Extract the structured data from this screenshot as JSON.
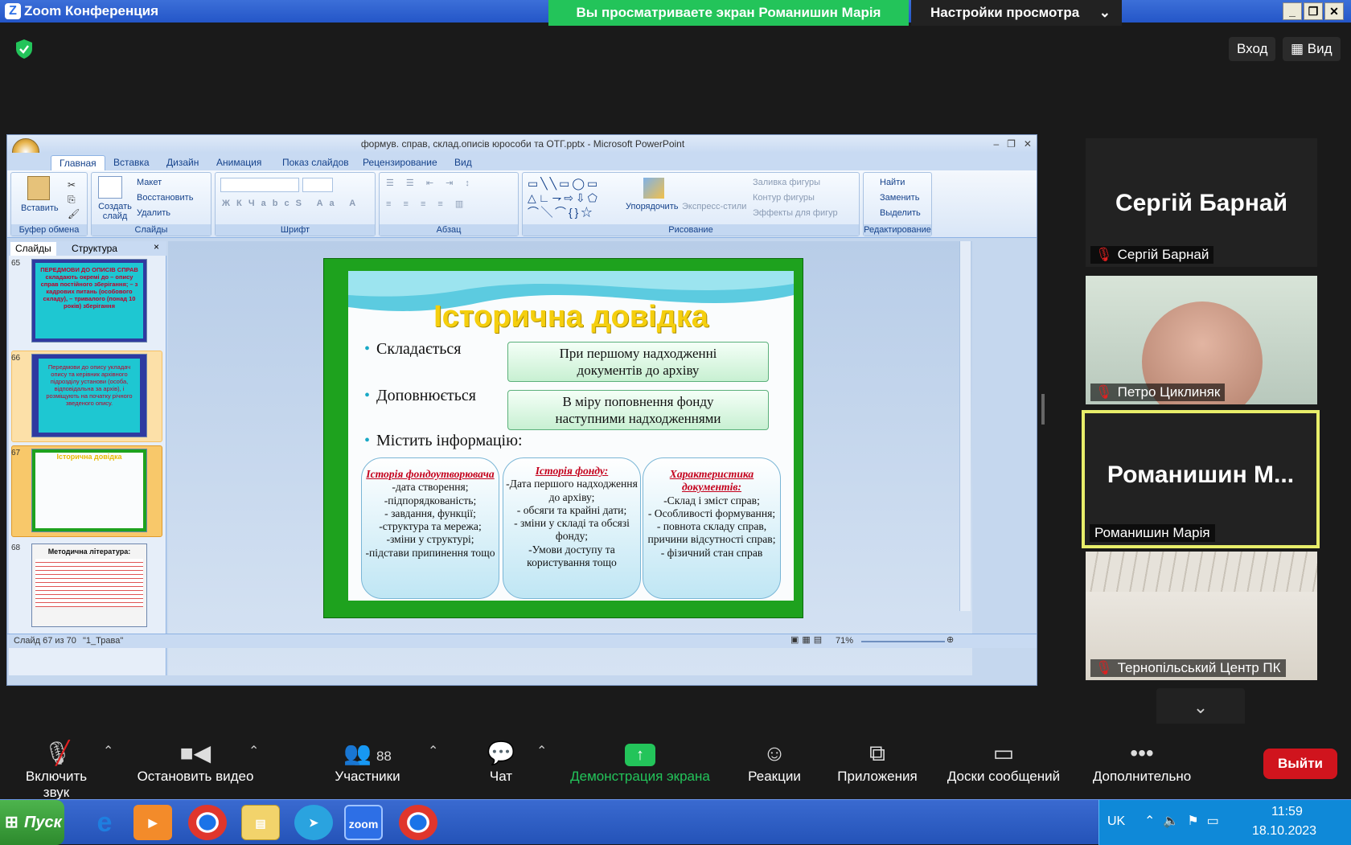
{
  "window": {
    "title": "Zoom Конференция",
    "logo_letter": "Z",
    "viewing_banner": "Вы просматриваете экран Романишин Марія",
    "view_settings": "Настройки просмотра"
  },
  "top_right": {
    "signin": "Вход",
    "view": "Вид"
  },
  "ppt": {
    "title": "формув. справ, склад.описів юрособи та ОТГ.pptx - Microsoft PowerPoint",
    "tabs": [
      "Главная",
      "Вставка",
      "Дизайн",
      "Анимация",
      "Показ слайдов",
      "Рецензирование",
      "Вид"
    ],
    "ribbon": {
      "paste": "Вставить",
      "clipboard_group": "Буфер обмена",
      "create_slide": "Создать слайд",
      "layout": "Макет",
      "restore": "Восстановить",
      "delete": "Удалить",
      "slides_group": "Слайды",
      "font_group": "Шрифт",
      "paragraph_group": "Абзац",
      "arrange": "Упорядочить",
      "express_styles": "Экспресс-стили",
      "shape_fill": "Заливка фигуры",
      "shape_outline": "Контур фигуры",
      "shape_effects": "Эффекты для фигур",
      "drawing_group": "Рисование",
      "find": "Найти",
      "replace": "Заменить",
      "select": "Выделить",
      "editing_group": "Редактирование"
    },
    "pane_tabs": {
      "slides": "Слайды",
      "outline": "Структура"
    },
    "thumbs": [
      {
        "num": "65",
        "text": "ПЕРЕДМОВИ ДО ОПИСІВ СПРАВ складають окремі до – опису справ постійного зберігання; – з кадрових питань (особового складу), – тривалого (понад 10 років) зберігання"
      },
      {
        "num": "66",
        "text": "Передмови до опису укладач опису та керівник архівного підрозділу установи (особа, відповідальна за архів), і розміщують на початку річного зведеного опису."
      },
      {
        "num": "67",
        "text": "Історична довідка"
      },
      {
        "num": "68",
        "text": "Методична література:"
      }
    ],
    "status": {
      "slide_info": "Слайд 67 из 70",
      "theme": "\"1_Трава\"",
      "zoom": "71%"
    }
  },
  "slide": {
    "title": "Історична довідка",
    "bullets": [
      "Складається",
      "Доповнюється",
      "Містить інформацію:"
    ],
    "box1": [
      "При першому надходженні",
      "документів до архіву"
    ],
    "box2": [
      "В міру поповнення фонду",
      "наступними надходженнями"
    ],
    "cards": [
      {
        "heading": "Історія фондоутворювача",
        "lines": [
          "-дата створення;",
          "-підпорядкованість;",
          "- завдання, функції;",
          "-структура та мережа;",
          "-зміни у структурі;",
          "-підстави припинення тощо"
        ]
      },
      {
        "heading": "Історія фонду:",
        "lines": [
          "-Дата першого надходження до архіву;",
          "- обсяги та крайні дати;",
          "- зміни у складі та обсязі фонду;",
          "-Умови доступу та користування тощо"
        ]
      },
      {
        "heading": "Характеристика документів:",
        "lines": [
          "-Склад і зміст справ;",
          "- Особливості формування;",
          "- повнота складу справ, причини відсутності справ;",
          "- фізичний стан справ"
        ]
      }
    ]
  },
  "participants_tiles": [
    {
      "big": "Сергій Барнай",
      "label": "Сергій Барнай"
    },
    {
      "big": "",
      "label": "Петро Циклиняк"
    },
    {
      "big": "Романишин  М...",
      "label": "Романишин Марія"
    },
    {
      "big": "",
      "label": "Тернопільський Центр ПК"
    }
  ],
  "toolbar": {
    "unmute": "Включить звук",
    "stop_video": "Остановить видео",
    "participants": "Участники",
    "participants_count": "88",
    "chat": "Чат",
    "share": "Демонстрация экрана",
    "reactions": "Реакции",
    "apps": "Приложения",
    "whiteboards": "Доски сообщений",
    "more": "Дополнительно",
    "leave": "Выйти"
  },
  "taskbar": {
    "start": "Пуск",
    "zoom_label": "zoom",
    "lang": "UK",
    "time": "11:59",
    "date": "18.10.2023"
  },
  "colors": {
    "zoom_green": "#23c45a",
    "leave_red": "#d0141d",
    "active_speaker": "#e8ee6a",
    "slide_green": "#1ea21e",
    "title_yellow": "#f5cf0e"
  }
}
